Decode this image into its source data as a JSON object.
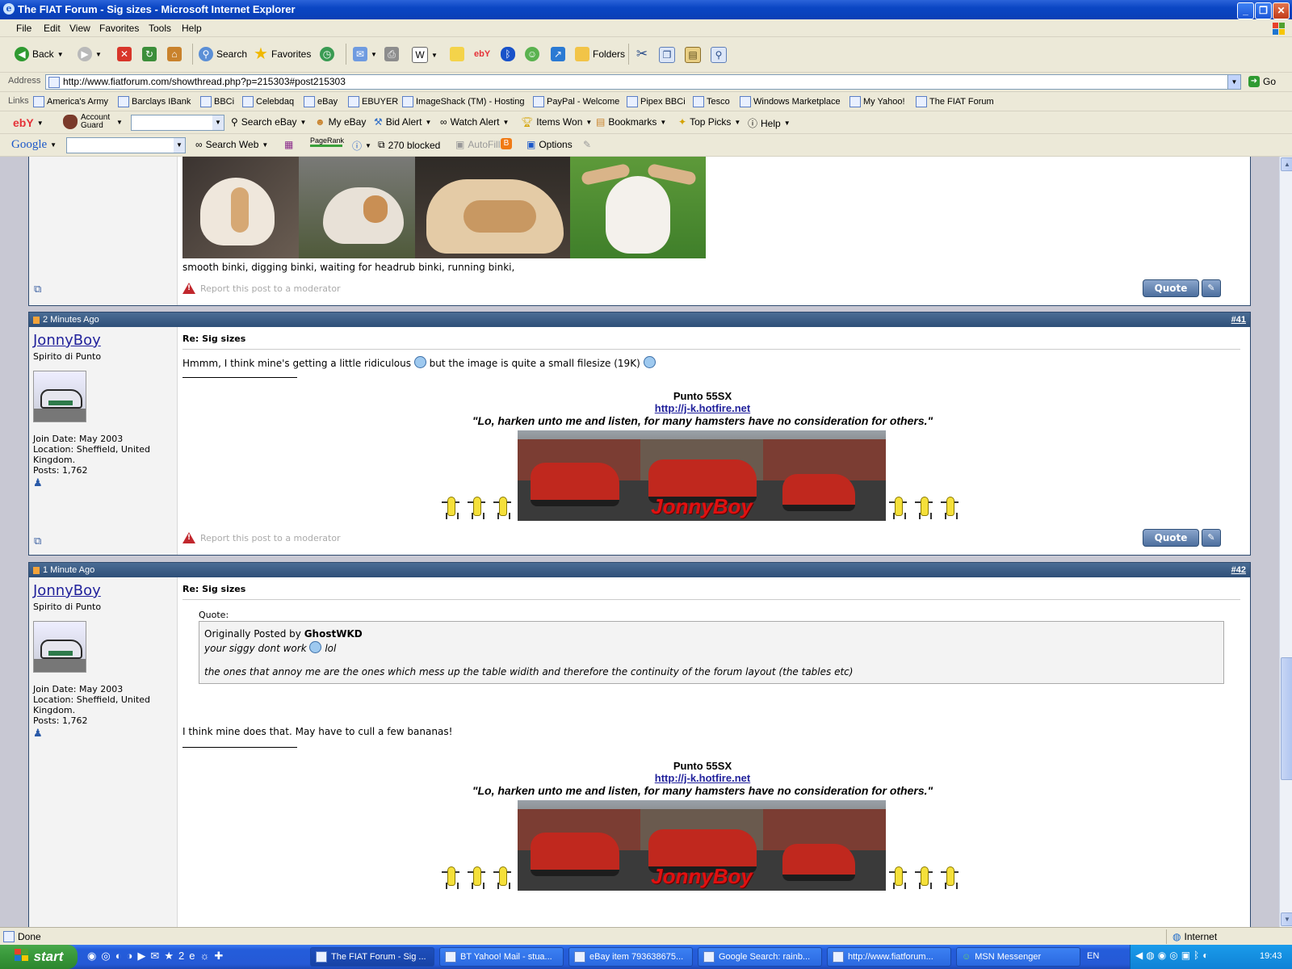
{
  "window": {
    "title": "The FIAT Forum - Sig sizes - Microsoft Internet Explorer",
    "controls": [
      "minimize",
      "maximize",
      "close"
    ]
  },
  "menu": [
    "File",
    "Edit",
    "View",
    "Favorites",
    "Tools",
    "Help"
  ],
  "toolbar": {
    "back": "Back",
    "search": "Search",
    "favorites": "Favorites",
    "folders": "Folders"
  },
  "address": {
    "label": "Address",
    "url": "http://www.fiatforum.com/showthread.php?p=215303#post215303",
    "go": "Go"
  },
  "links": {
    "label": "Links",
    "items": [
      "America's Army",
      "Barclays IBank",
      "BBCi",
      "Celebdaq",
      "eBay",
      "EBUYER",
      "ImageShack (TM) - Hosting",
      "PayPal - Welcome",
      "Pipex BBCi",
      "Tesco",
      "Windows Marketplace",
      "My Yahoo!",
      "The FIAT Forum"
    ]
  },
  "ebay_toolbar": {
    "account_guard": "Account Guard",
    "search_ebay": "Search eBay",
    "my_ebay": "My eBay",
    "bid_alert": "Bid Alert",
    "watch_alert": "Watch Alert",
    "items_won": "Items Won",
    "bookmarks": "Bookmarks",
    "top_picks": "Top Picks",
    "help": "Help"
  },
  "google_toolbar": {
    "brand": "Google",
    "search_web": "Search Web",
    "pagerank": "PageRank",
    "blocked": "270 blocked",
    "autofill": "AutoFill",
    "options": "Options"
  },
  "post_top": {
    "caption": "smooth binki, digging binki, waiting for headrub binki, running binki,",
    "report": "Report this post to a moderator",
    "quote": "Quote"
  },
  "post41": {
    "time": "2 Minutes Ago",
    "number": "#41",
    "username": "JonnyBoy",
    "user_title": "Spirito di Punto",
    "join_date": "Join Date: May 2003",
    "location": "Location: Sheffield, United Kingdom.",
    "posts": "Posts: 1,762",
    "subject": "Re: Sig sizes",
    "body_before": "Hmmm, I think mine's getting a little ridiculous",
    "body_middle": "but the image is quite a small filesize (19K)",
    "report": "Report this post to a moderator",
    "quote": "Quote"
  },
  "post42": {
    "time": "1 Minute Ago",
    "number": "#42",
    "username": "JonnyBoy",
    "user_title": "Spirito di Punto",
    "join_date": "Join Date: May 2003",
    "location": "Location: Sheffield, United Kingdom.",
    "posts": "Posts: 1,762",
    "subject": "Re: Sig sizes",
    "quote_label": "Quote:",
    "quote_author_prefix": "Originally Posted by",
    "quote_author": "GhostWKD",
    "quote_line1": "your siggy dont work",
    "quote_line1_end": "lol",
    "quote_line2": "the ones that annoy me are the ones which mess up the table widith and therefore the continuity of the forum layout (the tables etc)",
    "body": "I think mine does that. May have to cull a few bananas!"
  },
  "signature": {
    "car": "Punto 55SX",
    "link": "http://j-k.hotfire.net",
    "motto": "\"Lo, harken unto me and listen, for many hamsters have no consideration for others.\"",
    "banner_text": "JonnyBoy"
  },
  "status": {
    "text": "Done",
    "zone": "Internet"
  },
  "taskbar": {
    "start": "start",
    "tasks": [
      "The FIAT Forum - Sig ...",
      "BT Yahoo! Mail - stua...",
      "eBay item 793638675...",
      "Google Search: rainb...",
      "http://www.fiatforum...",
      "MSN Messenger"
    ],
    "lang": "EN",
    "clock": "19:43"
  }
}
